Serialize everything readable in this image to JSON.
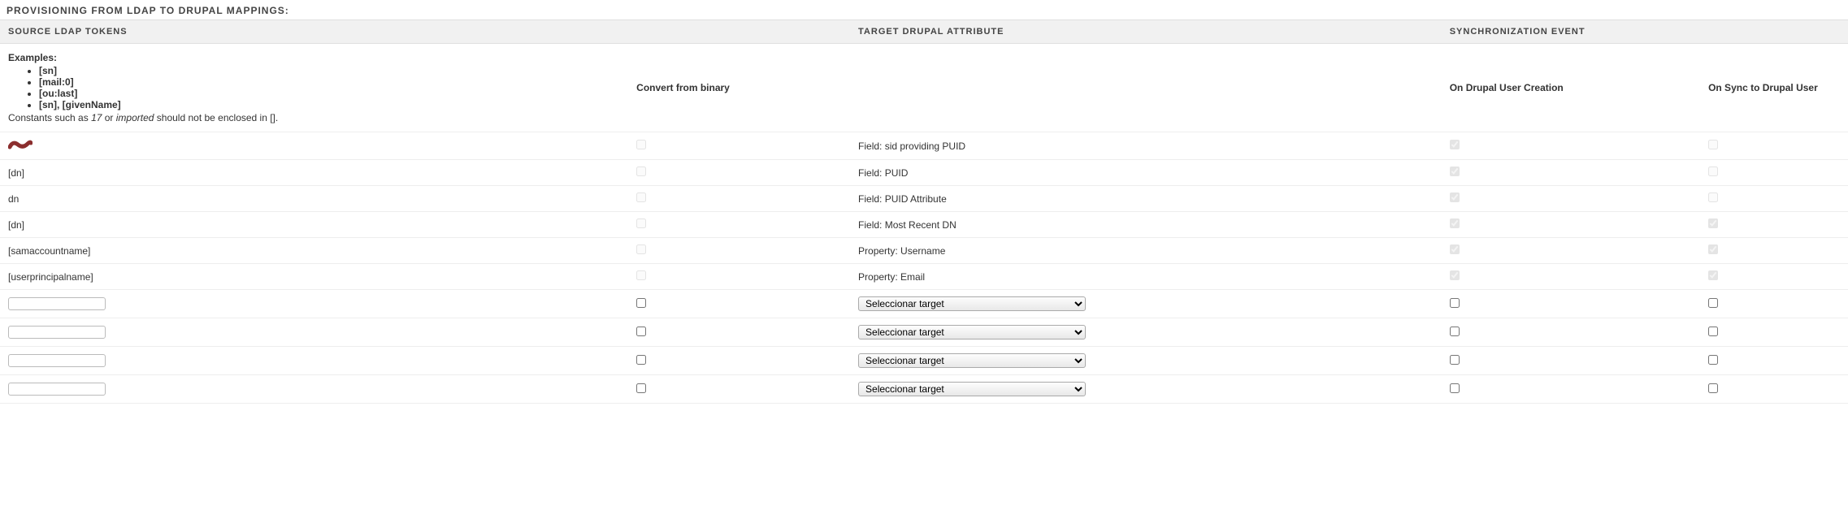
{
  "section_title": "PROVISIONING FROM LDAP TO DRUPAL MAPPINGS:",
  "headers": {
    "source": "SOURCE LDAP TOKENS",
    "target": "TARGET DRUPAL ATTRIBUTE",
    "sync_event": "SYNCHRONIZATION EVENT"
  },
  "subheaders": {
    "examples_title": "Examples:",
    "examples": [
      "[sn]",
      "[mail:0]",
      "[ou:last]",
      "[sn], [givenName]"
    ],
    "footnote_prefix": "Constants such as ",
    "footnote_em1": "17",
    "footnote_mid": " or ",
    "footnote_em2": "imported",
    "footnote_suffix": " should not be enclosed in [].",
    "convert_binary": "Convert from binary",
    "on_creation": "On Drupal User Creation",
    "on_sync": "On Sync to Drupal User"
  },
  "select_placeholder": "Seleccionar target",
  "rows": [
    {
      "type": "preset",
      "source": "__worm__",
      "binary": {
        "checked": false,
        "disabled": true
      },
      "target": "Field: sid providing PUID",
      "creation": {
        "checked": true,
        "disabled": true
      },
      "sync": {
        "checked": false,
        "disabled": true
      }
    },
    {
      "type": "preset",
      "source": "[dn]",
      "binary": {
        "checked": false,
        "disabled": true
      },
      "target": "Field: PUID",
      "creation": {
        "checked": true,
        "disabled": true
      },
      "sync": {
        "checked": false,
        "disabled": true
      }
    },
    {
      "type": "preset",
      "source": "dn",
      "binary": {
        "checked": false,
        "disabled": true
      },
      "target": "Field: PUID Attribute",
      "creation": {
        "checked": true,
        "disabled": true
      },
      "sync": {
        "checked": false,
        "disabled": true
      }
    },
    {
      "type": "preset",
      "source": "[dn]",
      "binary": {
        "checked": false,
        "disabled": true
      },
      "target": "Field: Most Recent DN",
      "creation": {
        "checked": true,
        "disabled": true
      },
      "sync": {
        "checked": true,
        "disabled": true
      }
    },
    {
      "type": "preset",
      "source": "[samaccountname]",
      "binary": {
        "checked": false,
        "disabled": true
      },
      "target": "Property: Username",
      "creation": {
        "checked": true,
        "disabled": true
      },
      "sync": {
        "checked": true,
        "disabled": true
      }
    },
    {
      "type": "preset",
      "source": "[userprincipalname]",
      "binary": {
        "checked": false,
        "disabled": true
      },
      "target": "Property: Email",
      "creation": {
        "checked": true,
        "disabled": true
      },
      "sync": {
        "checked": true,
        "disabled": true
      }
    },
    {
      "type": "custom",
      "source": "",
      "binary": {
        "checked": false,
        "disabled": false
      },
      "creation": {
        "checked": false,
        "disabled": false
      },
      "sync": {
        "checked": false,
        "disabled": false
      }
    },
    {
      "type": "custom",
      "source": "",
      "binary": {
        "checked": false,
        "disabled": false
      },
      "creation": {
        "checked": false,
        "disabled": false
      },
      "sync": {
        "checked": false,
        "disabled": false
      }
    },
    {
      "type": "custom",
      "source": "",
      "binary": {
        "checked": false,
        "disabled": false
      },
      "creation": {
        "checked": false,
        "disabled": false
      },
      "sync": {
        "checked": false,
        "disabled": false
      }
    },
    {
      "type": "custom",
      "source": "",
      "binary": {
        "checked": false,
        "disabled": false
      },
      "creation": {
        "checked": false,
        "disabled": false
      },
      "sync": {
        "checked": false,
        "disabled": false
      }
    }
  ]
}
